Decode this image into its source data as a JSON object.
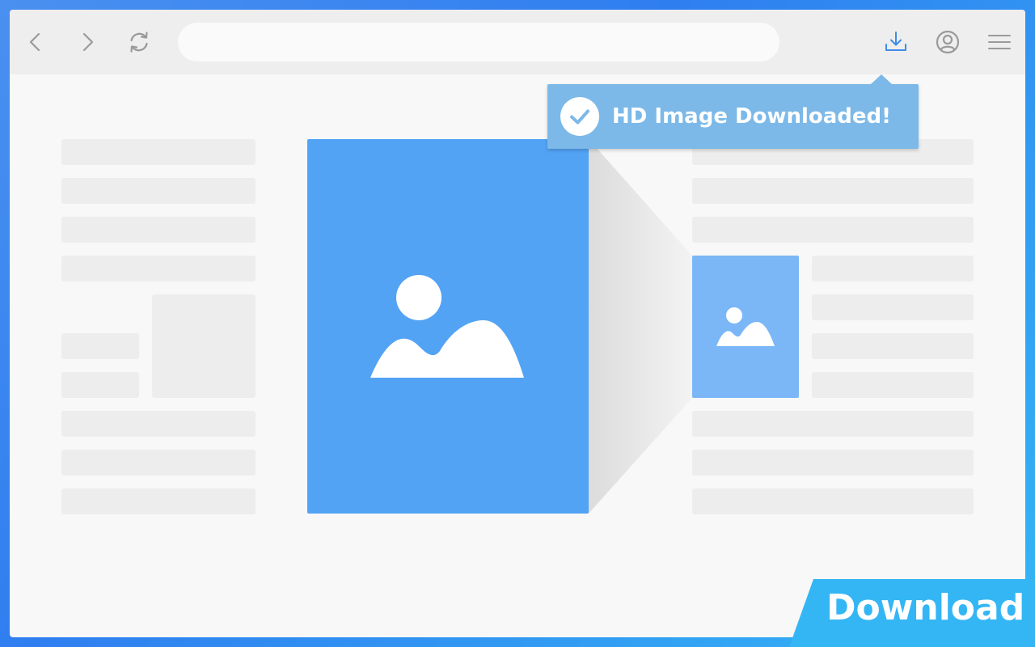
{
  "toolbar": {
    "icons": [
      "back-arrow-icon",
      "forward-arrow-icon",
      "reload-icon",
      "download-icon",
      "account-icon",
      "menu-icon"
    ],
    "url_value": "",
    "accent_color": "#3d8ce8",
    "icon_color": "#9a9a9a"
  },
  "toast": {
    "message": "HD Image Downloaded!",
    "icon": "checkmark-icon"
  },
  "content": {
    "hero_image_icon": "image-icon",
    "thumb_image_icon": "image-icon"
  },
  "badge": {
    "label": "Download"
  },
  "colors": {
    "hero": "#53a3f5",
    "thumb": "#7bb6f6",
    "toast": "#7cb9e8",
    "badge": "#34b6f5"
  }
}
